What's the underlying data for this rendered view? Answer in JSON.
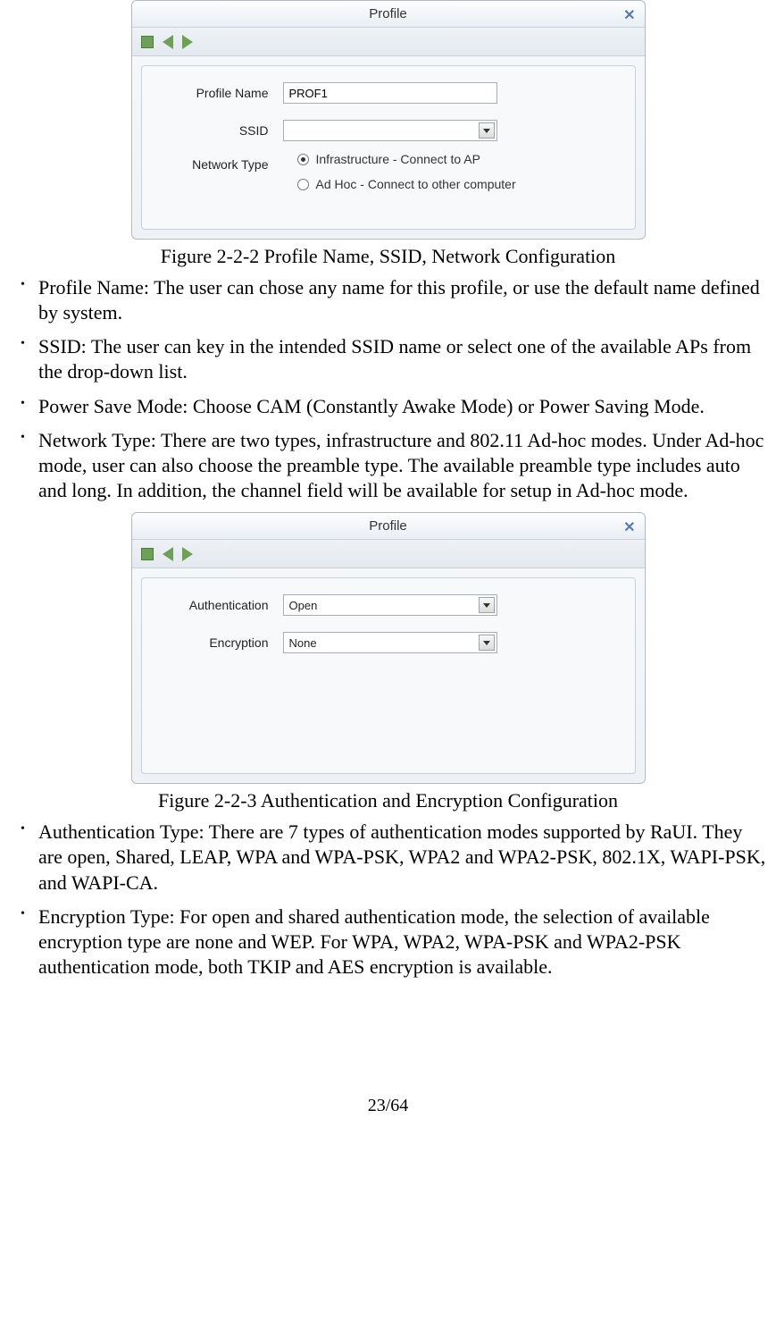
{
  "dialog1": {
    "title": "Profile",
    "profileName": {
      "label": "Profile Name",
      "value": "PROF1"
    },
    "ssid": {
      "label": "SSID",
      "value": ""
    },
    "networkType": {
      "label": "Network Type",
      "option1": "Infrastructure - Connect to AP",
      "option2": "Ad Hoc - Connect to other computer"
    }
  },
  "caption1": "Figure 2-2-2 Profile Name, SSID, Network Configuration",
  "bullets1": [
    "Profile Name: The user can chose any name for this profile, or use the default name defined by system.",
    "SSID: The user can key in the intended SSID name or select one of the available APs from the drop-down list.",
    "Power Save Mode: Choose CAM (Constantly Awake Mode) or Power Saving Mode.",
    "Network Type: There are two types, infrastructure and 802.11 Ad-hoc modes. Under Ad-hoc mode, user can also choose the preamble type. The available preamble type includes auto and long. In addition, the channel field will be available for setup in Ad-hoc mode."
  ],
  "dialog2": {
    "title": "Profile",
    "auth": {
      "label": "Authentication",
      "value": "Open"
    },
    "enc": {
      "label": "Encryption",
      "value": "None"
    }
  },
  "caption2": "Figure 2-2-3 Authentication and Encryption Configuration",
  "bullets2": [
    "Authentication Type: There are 7 types of authentication modes supported by RaUI. They are open, Shared, LEAP, WPA and WPA-PSK, WPA2 and WPA2-PSK, 802.1X, WAPI-PSK, and WAPI-CA.",
    "Encryption Type: For open and shared authentication mode, the selection of available encryption type are none and WEP. For WPA, WPA2, WPA-PSK and WPA2-PSK authentication mode, both TKIP and AES encryption is available."
  ],
  "pageNumber": "23/64"
}
